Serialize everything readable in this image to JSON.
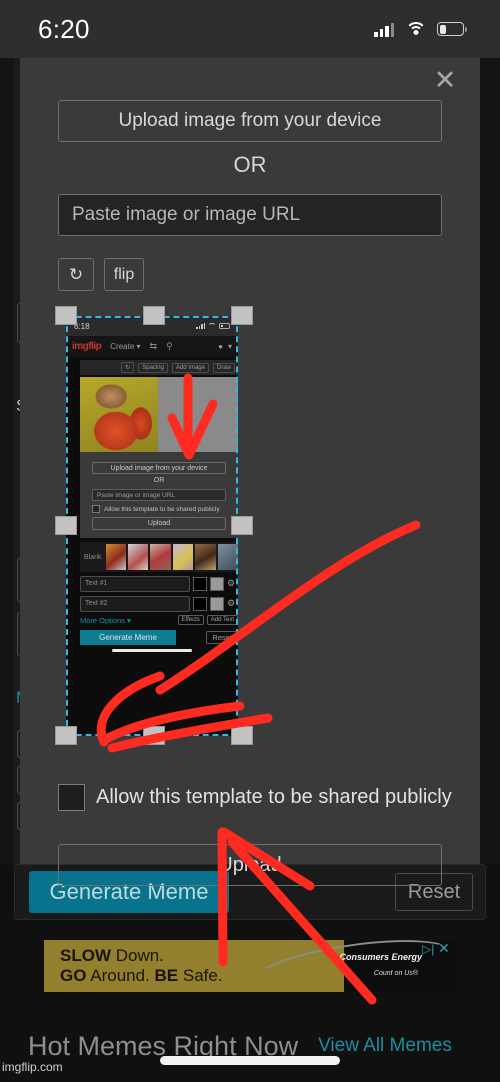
{
  "status_bar": {
    "time": "6:20",
    "icons": [
      "signal-icon",
      "wifi-icon",
      "battery-icon"
    ],
    "battery_level_pct": 28
  },
  "modal": {
    "close_label": "✕",
    "upload_device_label": "Upload image from your device",
    "or_label": "OR",
    "url_placeholder": "Paste image or image URL",
    "url_value": "",
    "rotate_label": "↻",
    "flip_label": "flip",
    "share_checkbox_label": "Allow this template to be shared publicly",
    "share_checkbox_checked": false,
    "upload_label": "Upload"
  },
  "cropper": {
    "selection_style": "dashed",
    "selection_color": "#31b7e8",
    "handle_count": 8
  },
  "nested_screenshot": {
    "status_bar": {
      "time": "6:18"
    },
    "nav": {
      "logo": "imgflip",
      "create_label": "Create ▾",
      "shuffle_icon": "shuffle-icon",
      "search_icon": "search-icon"
    },
    "toolbar": {
      "rotate_icon": "rotate-icon",
      "spacing_label": "Spacing",
      "add_image_label": "Add Image",
      "draw_label": "Draw"
    },
    "meme_preview": {
      "left_panel": "drake-photo",
      "right_panel": "blank-gray-panel",
      "close_label": "✕"
    },
    "panel": {
      "upload_device_label": "Upload image from your device",
      "or_label": "OR",
      "url_placeholder": "Paste image or image URL",
      "share_checkbox_label": "Allow this template to be shared publicly",
      "upload_label": "Upload"
    },
    "templates": {
      "blank_label": "Blank",
      "thumbs": [
        "#b4413c",
        "#d0c8c4",
        "#bfa9a2",
        "#c9b7d4",
        "#d6c25a",
        "#6a7d8c"
      ]
    },
    "text_rows": [
      {
        "placeholder": "Text #1",
        "color_swatch": "#000000",
        "outline_swatch": "#9a9a9a",
        "gear_icon": "gear-icon"
      },
      {
        "placeholder": "Text #2",
        "color_swatch": "#000000",
        "outline_swatch": "#9a9a9a",
        "gear_icon": "gear-icon"
      }
    ],
    "options": {
      "more_options_label": "More Options ▾",
      "effects_label": "Effects",
      "add_text_label": "Add Text"
    },
    "footer": {
      "generate_label": "Generate Meme",
      "reset_label": "Reset"
    }
  },
  "page_footer": {
    "generate_label": "Generate Meme",
    "reset_label": "Reset"
  },
  "ad": {
    "line1_bold": "SLOW",
    "line1_rest": " Down.",
    "line2_bold": "GO",
    "line2_rest": " Around. ",
    "line2_bold2": "BE",
    "line2_rest2": " Safe.",
    "brand": "Consumers Energy",
    "tagline": "Count on Us®",
    "adchoices_icon": "adchoices-icon",
    "close_label": "✕"
  },
  "hot_section": {
    "title": "Hot Memes Right Now",
    "view_all_label": "View All Memes"
  },
  "watermark": "imgflip.com",
  "annotations": {
    "color": "#ff2a20",
    "strokes": [
      "arrow-down-on-preview",
      "scribble-at-checkbox",
      "arrow-up-at-upload"
    ]
  }
}
